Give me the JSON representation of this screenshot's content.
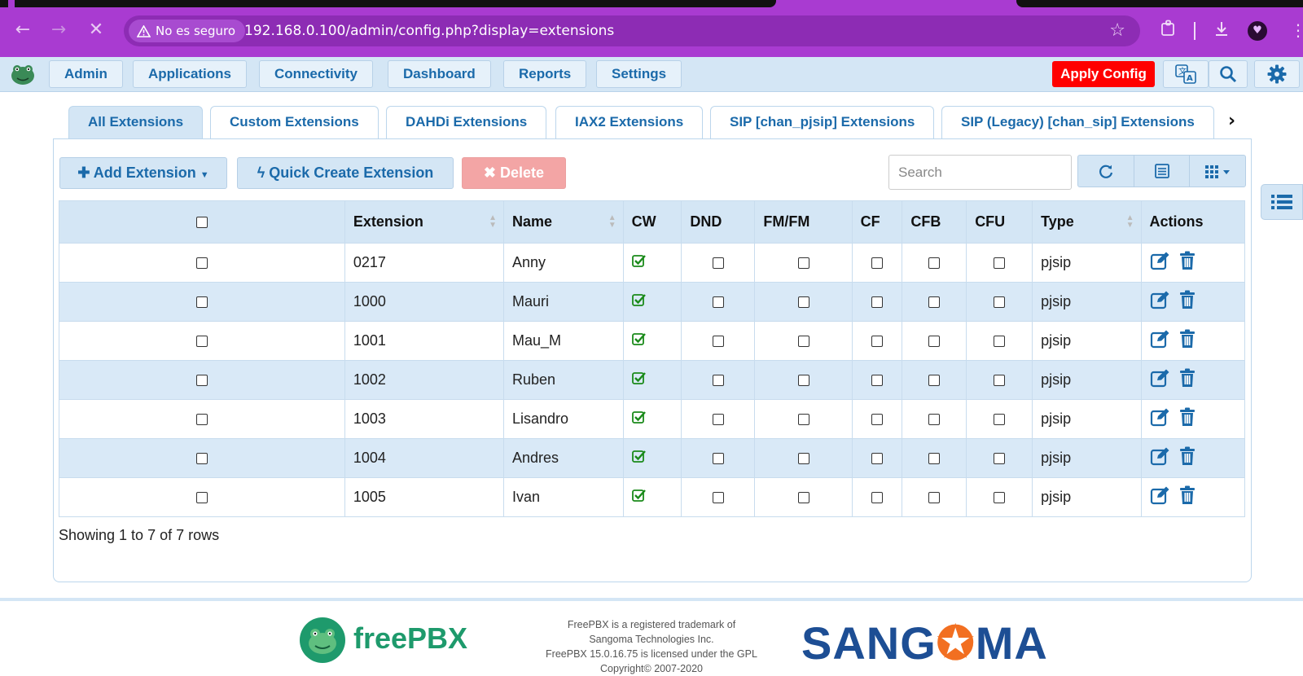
{
  "browser": {
    "security_label": "No es seguro",
    "url": "192.168.0.100/admin/config.php?display=extensions"
  },
  "nav": {
    "items": [
      "Admin",
      "Applications",
      "Connectivity",
      "Dashboard",
      "Reports",
      "Settings"
    ],
    "apply_config": "Apply Config"
  },
  "tabs": [
    "All Extensions",
    "Custom Extensions",
    "DAHDi Extensions",
    "IAX2 Extensions",
    "SIP [chan_pjsip] Extensions",
    "SIP (Legacy) [chan_sip] Extensions"
  ],
  "toolbar": {
    "add_label": "Add Extension",
    "quick_label": "Quick Create Extension",
    "delete_label": "Delete",
    "search_placeholder": "Search"
  },
  "table": {
    "columns": [
      "Extension",
      "Name",
      "CW",
      "DND",
      "FM/FM",
      "CF",
      "CFB",
      "CFU",
      "Type",
      "Actions"
    ],
    "rows": [
      {
        "extension": "0217",
        "name": "Anny",
        "type": "pjsip"
      },
      {
        "extension": "1000",
        "name": "Mauri",
        "type": "pjsip"
      },
      {
        "extension": "1001",
        "name": "Mau_M",
        "type": "pjsip"
      },
      {
        "extension": "1002",
        "name": "Ruben",
        "type": "pjsip"
      },
      {
        "extension": "1003",
        "name": "Lisandro",
        "type": "pjsip"
      },
      {
        "extension": "1004",
        "name": "Andres",
        "type": "pjsip"
      },
      {
        "extension": "1005",
        "name": "Ivan",
        "type": "pjsip"
      }
    ],
    "status": "Showing 1 to 7 of 7 rows"
  },
  "footer": {
    "brand": "freePBX",
    "line1": "FreePBX is a registered trademark of",
    "line2": "Sangoma Technologies Inc.",
    "line3": "FreePBX 15.0.16.75 is licensed under the GPL",
    "line4": "Copyright© 2007-2020",
    "sangoma_pre": "SANG",
    "sangoma_post": "MA"
  },
  "colors": {
    "browser_accent": "#a93bd1",
    "app_nav_bg": "#d4e6f5",
    "link_blue": "#1b6aaa",
    "apply_red": "#ff0000",
    "check_green": "#1a8a1a"
  }
}
